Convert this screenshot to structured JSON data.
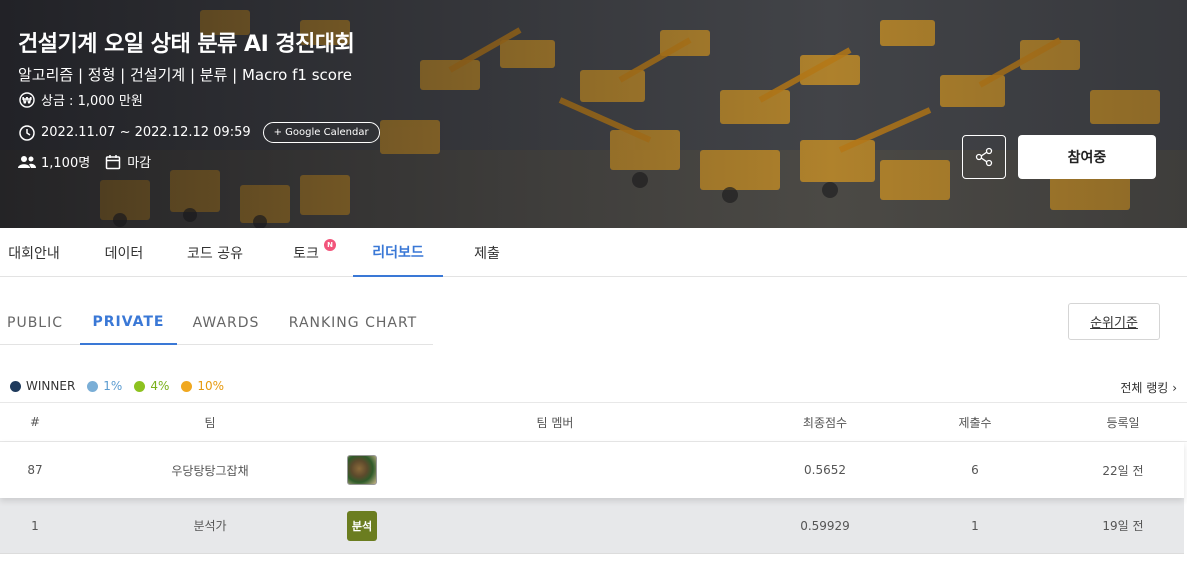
{
  "hero": {
    "title": "건설기계 오일 상태 분류 AI 경진대회",
    "tags": "알고리즘 | 정형 | 건설기계 | 분류 | Macro f1 score",
    "prize": "상금 : 1,000 만원",
    "period": "2022.11.07 ~ 2022.12.12 09:59",
    "google_calendar": "+ Google Calendar",
    "participants": "1,100명",
    "status": "마감",
    "join_label": "참여중"
  },
  "main_tabs": [
    {
      "label": "대회안내"
    },
    {
      "label": "데이터"
    },
    {
      "label": "코드 공유"
    },
    {
      "label": "토크",
      "badge": "N"
    },
    {
      "label": "리더보드"
    },
    {
      "label": "제출"
    }
  ],
  "sub_tabs": [
    {
      "label": "PUBLIC"
    },
    {
      "label": "PRIVATE"
    },
    {
      "label": "AWARDS"
    },
    {
      "label": "RANKING CHART"
    }
  ],
  "criteria_label": "순위기준",
  "legend": [
    {
      "label": "WINNER",
      "color": "#1e3a5c"
    },
    {
      "label": "1%",
      "color": "#7aaed6"
    },
    {
      "label": "4%",
      "color": "#8dc21f"
    },
    {
      "label": "10%",
      "color": "#f0a820"
    }
  ],
  "full_ranking_label": "전체 랭킹",
  "table": {
    "headers": {
      "rank": "#",
      "team": "팀",
      "members": "팀 멤버",
      "score": "최종점수",
      "submissions": "제출수",
      "date": "등록일"
    },
    "rows": [
      {
        "rank": "87",
        "team": "우당탕탕그잡채",
        "avatar": "",
        "score": "0.5652",
        "submissions": "6",
        "date": "22일 전"
      },
      {
        "rank": "1",
        "team": "분석가",
        "avatar": "분석",
        "score": "0.59929",
        "submissions": "1",
        "date": "19일 전"
      }
    ]
  },
  "colors": {
    "accent": "#3a78d6",
    "badge": "#f2557b"
  }
}
